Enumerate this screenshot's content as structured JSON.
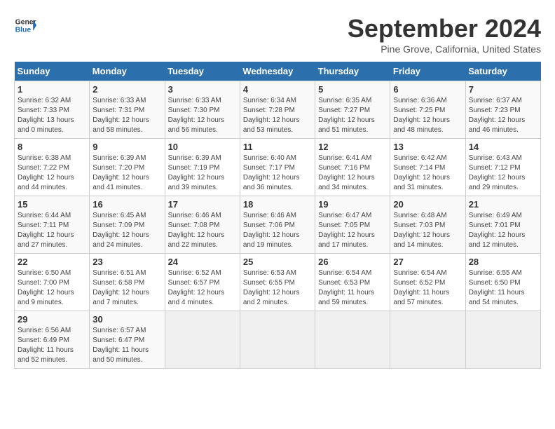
{
  "header": {
    "logo_line1": "General",
    "logo_line2": "Blue",
    "month": "September 2024",
    "location": "Pine Grove, California, United States"
  },
  "days_of_week": [
    "Sunday",
    "Monday",
    "Tuesday",
    "Wednesday",
    "Thursday",
    "Friday",
    "Saturday"
  ],
  "weeks": [
    [
      {
        "day": "1",
        "info": "Sunrise: 6:32 AM\nSunset: 7:33 PM\nDaylight: 13 hours\nand 0 minutes."
      },
      {
        "day": "2",
        "info": "Sunrise: 6:33 AM\nSunset: 7:31 PM\nDaylight: 12 hours\nand 58 minutes."
      },
      {
        "day": "3",
        "info": "Sunrise: 6:33 AM\nSunset: 7:30 PM\nDaylight: 12 hours\nand 56 minutes."
      },
      {
        "day": "4",
        "info": "Sunrise: 6:34 AM\nSunset: 7:28 PM\nDaylight: 12 hours\nand 53 minutes."
      },
      {
        "day": "5",
        "info": "Sunrise: 6:35 AM\nSunset: 7:27 PM\nDaylight: 12 hours\nand 51 minutes."
      },
      {
        "day": "6",
        "info": "Sunrise: 6:36 AM\nSunset: 7:25 PM\nDaylight: 12 hours\nand 48 minutes."
      },
      {
        "day": "7",
        "info": "Sunrise: 6:37 AM\nSunset: 7:23 PM\nDaylight: 12 hours\nand 46 minutes."
      }
    ],
    [
      {
        "day": "8",
        "info": "Sunrise: 6:38 AM\nSunset: 7:22 PM\nDaylight: 12 hours\nand 44 minutes."
      },
      {
        "day": "9",
        "info": "Sunrise: 6:39 AM\nSunset: 7:20 PM\nDaylight: 12 hours\nand 41 minutes."
      },
      {
        "day": "10",
        "info": "Sunrise: 6:39 AM\nSunset: 7:19 PM\nDaylight: 12 hours\nand 39 minutes."
      },
      {
        "day": "11",
        "info": "Sunrise: 6:40 AM\nSunset: 7:17 PM\nDaylight: 12 hours\nand 36 minutes."
      },
      {
        "day": "12",
        "info": "Sunrise: 6:41 AM\nSunset: 7:16 PM\nDaylight: 12 hours\nand 34 minutes."
      },
      {
        "day": "13",
        "info": "Sunrise: 6:42 AM\nSunset: 7:14 PM\nDaylight: 12 hours\nand 31 minutes."
      },
      {
        "day": "14",
        "info": "Sunrise: 6:43 AM\nSunset: 7:12 PM\nDaylight: 12 hours\nand 29 minutes."
      }
    ],
    [
      {
        "day": "15",
        "info": "Sunrise: 6:44 AM\nSunset: 7:11 PM\nDaylight: 12 hours\nand 27 minutes."
      },
      {
        "day": "16",
        "info": "Sunrise: 6:45 AM\nSunset: 7:09 PM\nDaylight: 12 hours\nand 24 minutes."
      },
      {
        "day": "17",
        "info": "Sunrise: 6:46 AM\nSunset: 7:08 PM\nDaylight: 12 hours\nand 22 minutes."
      },
      {
        "day": "18",
        "info": "Sunrise: 6:46 AM\nSunset: 7:06 PM\nDaylight: 12 hours\nand 19 minutes."
      },
      {
        "day": "19",
        "info": "Sunrise: 6:47 AM\nSunset: 7:05 PM\nDaylight: 12 hours\nand 17 minutes."
      },
      {
        "day": "20",
        "info": "Sunrise: 6:48 AM\nSunset: 7:03 PM\nDaylight: 12 hours\nand 14 minutes."
      },
      {
        "day": "21",
        "info": "Sunrise: 6:49 AM\nSunset: 7:01 PM\nDaylight: 12 hours\nand 12 minutes."
      }
    ],
    [
      {
        "day": "22",
        "info": "Sunrise: 6:50 AM\nSunset: 7:00 PM\nDaylight: 12 hours\nand 9 minutes."
      },
      {
        "day": "23",
        "info": "Sunrise: 6:51 AM\nSunset: 6:58 PM\nDaylight: 12 hours\nand 7 minutes."
      },
      {
        "day": "24",
        "info": "Sunrise: 6:52 AM\nSunset: 6:57 PM\nDaylight: 12 hours\nand 4 minutes."
      },
      {
        "day": "25",
        "info": "Sunrise: 6:53 AM\nSunset: 6:55 PM\nDaylight: 12 hours\nand 2 minutes."
      },
      {
        "day": "26",
        "info": "Sunrise: 6:54 AM\nSunset: 6:53 PM\nDaylight: 11 hours\nand 59 minutes."
      },
      {
        "day": "27",
        "info": "Sunrise: 6:54 AM\nSunset: 6:52 PM\nDaylight: 11 hours\nand 57 minutes."
      },
      {
        "day": "28",
        "info": "Sunrise: 6:55 AM\nSunset: 6:50 PM\nDaylight: 11 hours\nand 54 minutes."
      }
    ],
    [
      {
        "day": "29",
        "info": "Sunrise: 6:56 AM\nSunset: 6:49 PM\nDaylight: 11 hours\nand 52 minutes."
      },
      {
        "day": "30",
        "info": "Sunrise: 6:57 AM\nSunset: 6:47 PM\nDaylight: 11 hours\nand 50 minutes."
      },
      {
        "day": "",
        "info": ""
      },
      {
        "day": "",
        "info": ""
      },
      {
        "day": "",
        "info": ""
      },
      {
        "day": "",
        "info": ""
      },
      {
        "day": "",
        "info": ""
      }
    ]
  ]
}
